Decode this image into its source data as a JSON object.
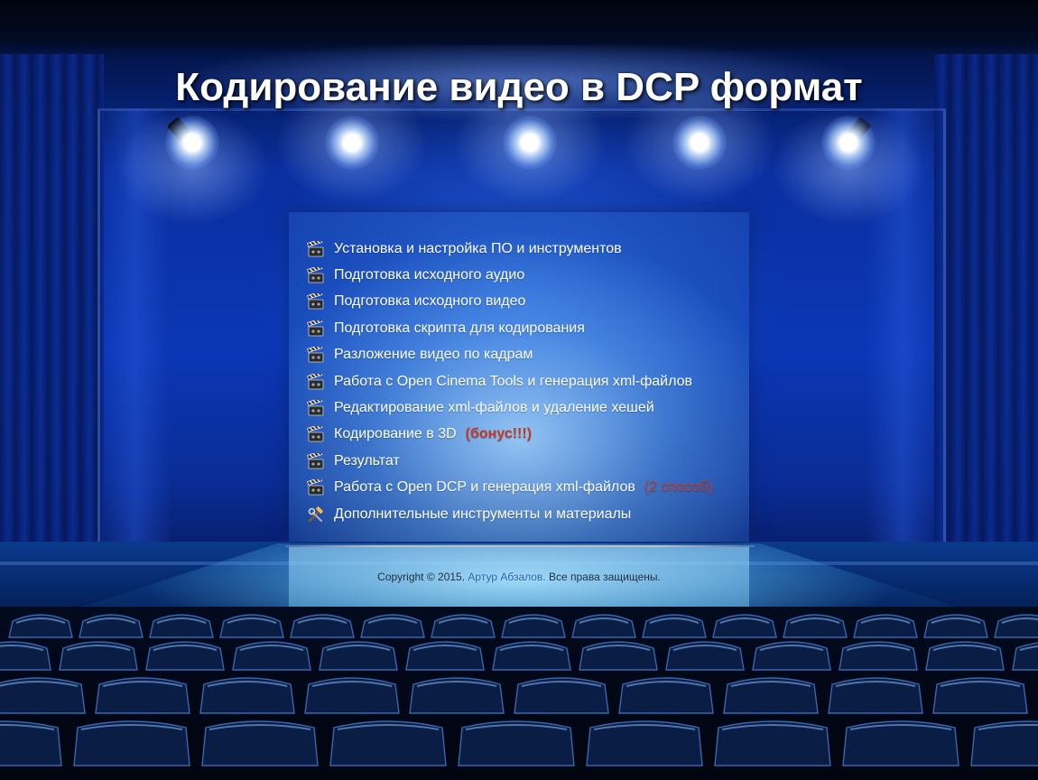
{
  "header": {
    "title": "Кодирование видео в DCP формат"
  },
  "menu": {
    "items": [
      {
        "label": "Установка и настройка ПО и инструментов",
        "icon": "film-clapper-icon",
        "accent": ""
      },
      {
        "label": "Подготовка исходного аудио",
        "icon": "film-clapper-icon",
        "accent": ""
      },
      {
        "label": "Подготовка исходного видео",
        "icon": "film-clapper-icon",
        "accent": ""
      },
      {
        "label": "Подготовка скрипта для кодирования",
        "icon": "film-clapper-icon",
        "accent": ""
      },
      {
        "label": "Разложение видео по кадрам",
        "icon": "film-clapper-icon",
        "accent": ""
      },
      {
        "label": "Работа с Open Cinema Tools и генерация xml-файлов",
        "icon": "film-clapper-icon",
        "accent": ""
      },
      {
        "label": "Редактирование xml-файлов и удаление хешей",
        "icon": "film-clapper-icon",
        "accent": ""
      },
      {
        "label": "Кодирование в 3D",
        "icon": "film-clapper-icon",
        "accent": "(бонус!!!)"
      },
      {
        "label": "Результат",
        "icon": "film-clapper-icon",
        "accent": ""
      },
      {
        "label": "Работа с Open DCP и генерация xml-файлов",
        "icon": "film-clapper-icon",
        "accent": "(2 способ)"
      },
      {
        "label": "Дополнительные инструменты и материалы",
        "icon": "hammer-wrench-icon",
        "accent": ""
      }
    ]
  },
  "footer": {
    "copyright": "Copyright © 2015.",
    "author": "Артур Абзалов.",
    "rights": "Все права защищены."
  },
  "colors": {
    "accent": "#c23a22",
    "link": "#1e5fb8",
    "title": "#ffffff"
  }
}
